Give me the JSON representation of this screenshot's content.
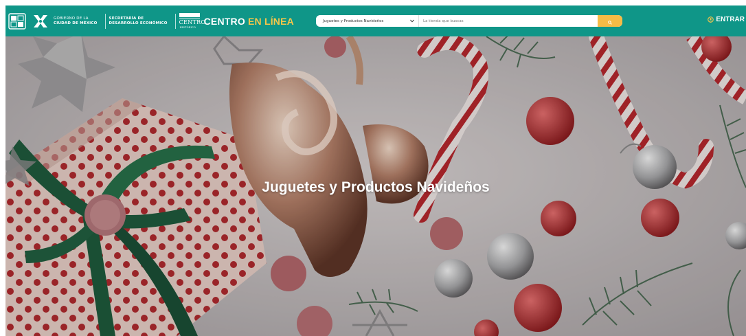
{
  "header": {
    "gov_line1": "Gobierno de la",
    "gov_line2": "Ciudad de México",
    "sec_line1": "Secretaría de",
    "sec_line2": "Desarrollo Económico",
    "centro_word": "CENTRO",
    "centro_sub": "HISTÓRICO",
    "brand_main": "CENTRO",
    "brand_accent": "EN LÍNEA",
    "bar_color": "#0f9688",
    "accent_color": "#f6c64a"
  },
  "search": {
    "category_value": "Juguetes y Productos Navideños",
    "placeholder": "La tienda que buscas",
    "button_icon": "search-icon",
    "button_color": "#f6bb46"
  },
  "login": {
    "icon": "user-circle-icon",
    "label": "ENTRAR"
  },
  "hero": {
    "title": "Juguetes y Productos Navideños"
  }
}
